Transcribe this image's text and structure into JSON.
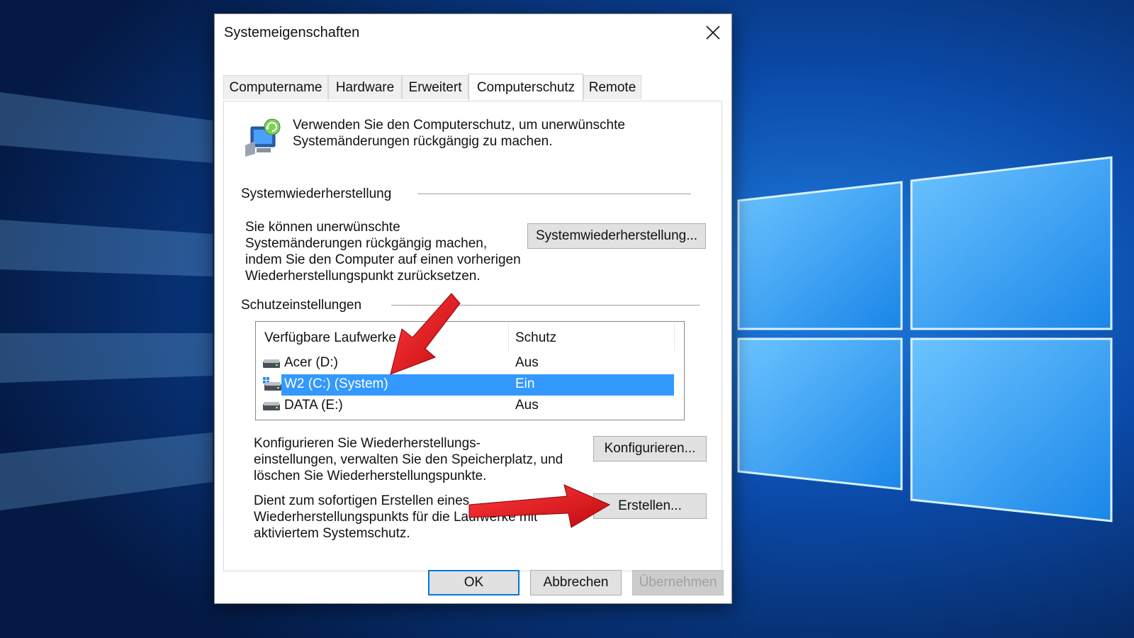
{
  "window": {
    "title": "Systemeigenschaften",
    "close_icon": "close-icon"
  },
  "tabs": [
    {
      "label": "Computername",
      "active": false
    },
    {
      "label": "Hardware",
      "active": false
    },
    {
      "label": "Erweitert",
      "active": false
    },
    {
      "label": "Computerschutz",
      "active": true
    },
    {
      "label": "Remote",
      "active": false
    }
  ],
  "intro": {
    "icon": "system-protection-icon",
    "line1": "Verwenden Sie den Computerschutz, um unerwünschte",
    "line2": "Systemänderungen rückgängig zu machen."
  },
  "system_restore": {
    "group_label": "Systemwiederherstellung",
    "desc_line1": "Sie können unerwünschte",
    "desc_line2": "Systemänderungen rückgängig machen,",
    "desc_line3": "indem Sie den Computer auf einen vorherigen",
    "desc_line4": "Wiederherstellungspunkt zurücksetzen.",
    "button_label": "Systemwiederherstellung..."
  },
  "protection_settings": {
    "group_label": "Schutzeinstellungen",
    "columns": [
      "Verfügbare Laufwerke",
      "Schutz"
    ],
    "drives": [
      {
        "name": "Acer (D:)",
        "status": "Aus",
        "icon": "drive-icon",
        "selected": false
      },
      {
        "name": "W2 (C:) (System)",
        "status": "Ein",
        "icon": "system-drive-icon",
        "selected": true
      },
      {
        "name": "DATA (E:)",
        "status": "Aus",
        "icon": "drive-icon",
        "selected": false
      }
    ]
  },
  "configure": {
    "desc_line1": "Konfigurieren Sie Wiederherstellungs-",
    "desc_line2": "einstellungen, verwalten Sie den Speicherplatz, und",
    "desc_line3": "löschen Sie Wiederherstellungspunkte.",
    "button_label": "Konfigurieren..."
  },
  "create": {
    "desc_line1": "Dient zum sofortigen Erstellen eines",
    "desc_line2": "Wiederherstellungspunkts für die Laufwerke mit",
    "desc_line3": "aktiviertem Systemschutz.",
    "button_label": "Erstellen..."
  },
  "footer": {
    "ok_label": "OK",
    "cancel_label": "Abbrechen",
    "apply_label": "Übernehmen"
  },
  "colors": {
    "selection": "#3399ff",
    "accent": "#0078d7",
    "annotation_arrow": "#e8141c",
    "desktop_blue": "#0b3d8c"
  }
}
